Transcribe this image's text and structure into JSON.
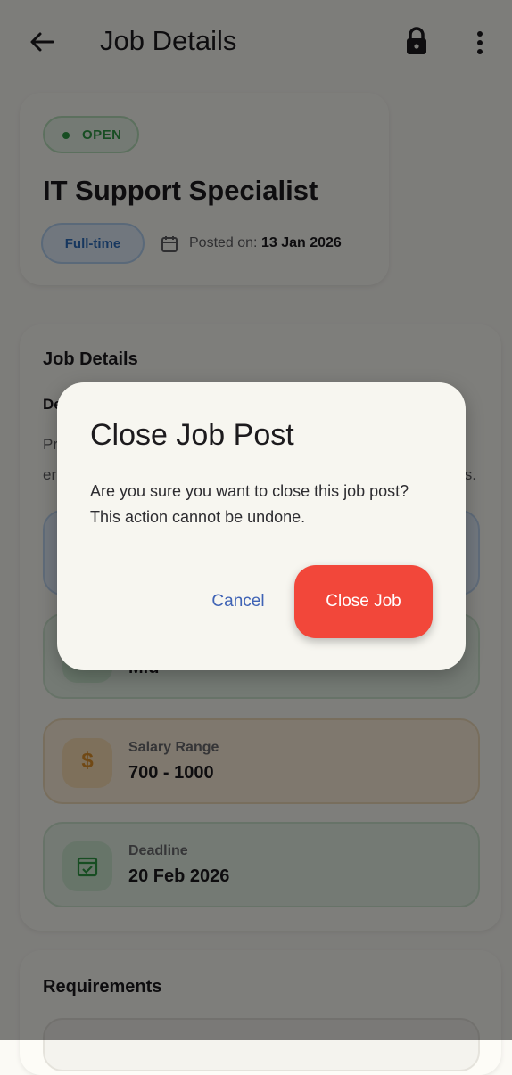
{
  "appbar": {
    "title": "Job Details",
    "back_icon": "arrow-left-icon",
    "lock_icon": "lock-icon",
    "more_icon": "more-vert-icon"
  },
  "job": {
    "status": "OPEN",
    "title": "IT Support Specialist",
    "type": "Full-time",
    "posted_label": "Posted on:",
    "posted_date": "13 Jan 2026"
  },
  "details": {
    "heading": "Job Details",
    "description_label": "De",
    "description_text": "Pr",
    "description_text_line2": "er",
    "description_trailing": "s.",
    "cards": [
      {
        "label": "",
        "value": "",
        "icon": "work-icon"
      },
      {
        "label": "",
        "value": "Mid",
        "icon": "level-icon"
      },
      {
        "label": "Salary Range",
        "value": "700 - 1000",
        "icon": "dollar-icon"
      },
      {
        "label": "Deadline",
        "value": "20 Feb 2026",
        "icon": "calendar-check-icon"
      }
    ]
  },
  "requirements": {
    "heading": "Requirements"
  },
  "dialog": {
    "title": "Close Job Post",
    "message": "Are you sure you want to close this job post? This action cannot be undone.",
    "cancel_label": "Cancel",
    "confirm_label": "Close Job"
  },
  "colors": {
    "scrim": "#00000080",
    "confirm_button": "#f2473a",
    "cancel_text": "#3f63b5",
    "status_green": "#2e9b45",
    "type_blue": "#2f6fbf"
  }
}
